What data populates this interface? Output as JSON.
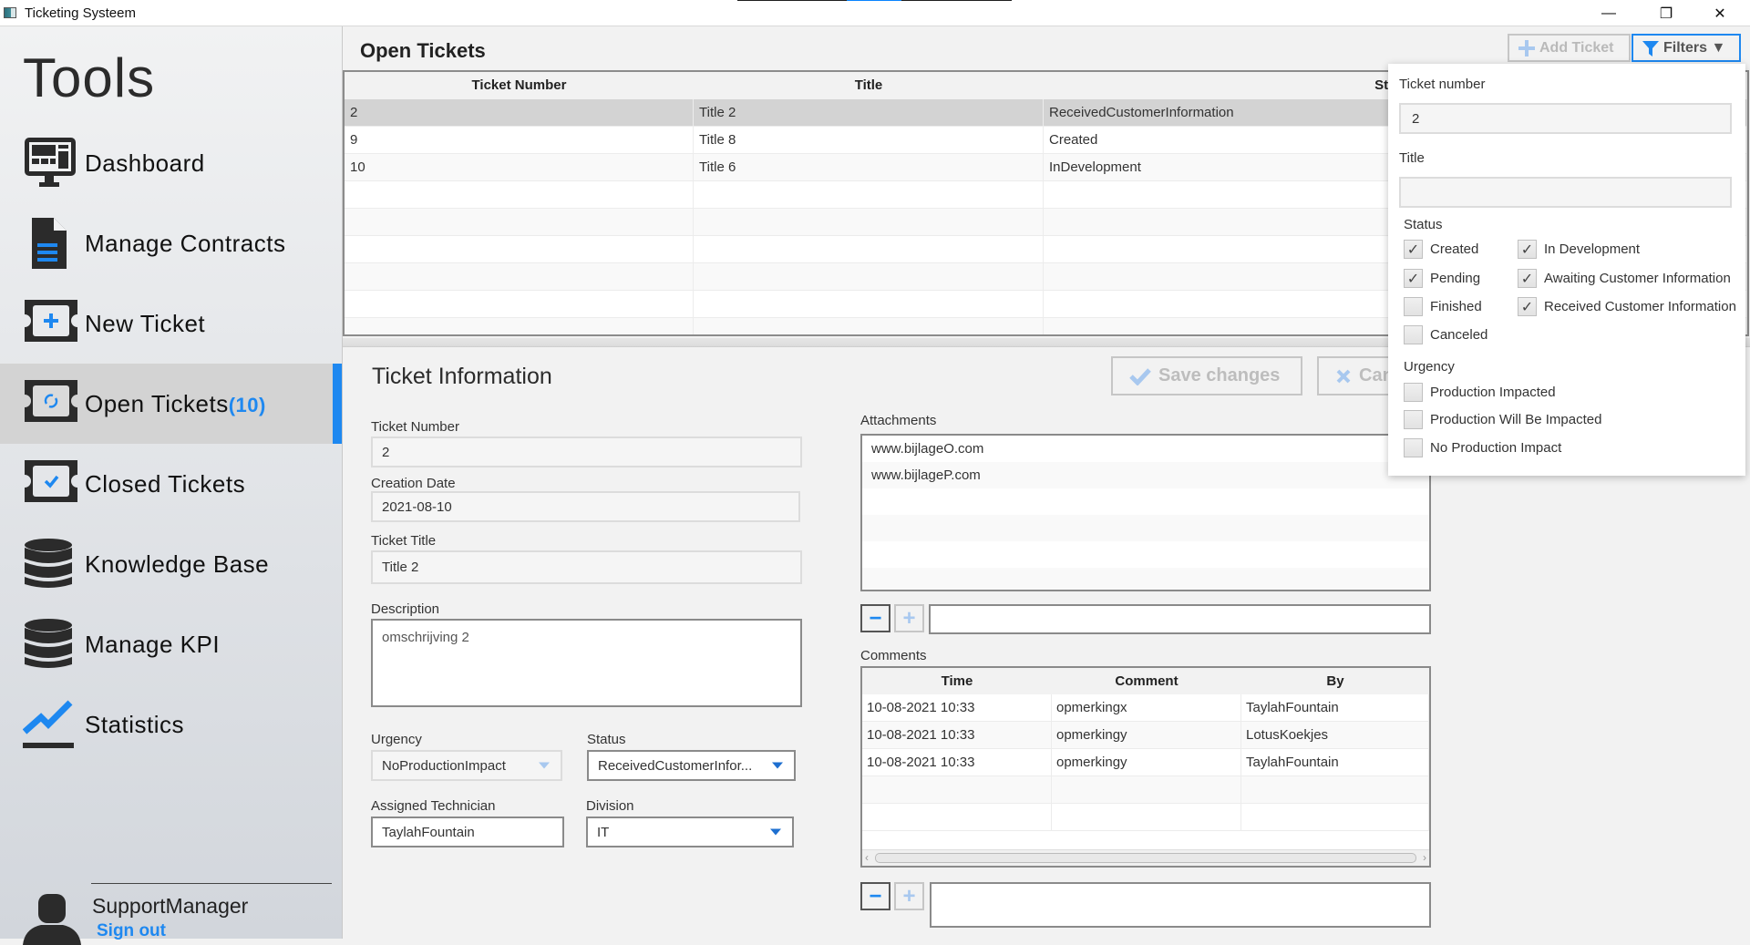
{
  "window": {
    "title": "Ticketing Systeem",
    "controls": {
      "minimize": "—",
      "maximize": "❐",
      "close": "✕"
    }
  },
  "sidebar": {
    "heading": "Tools",
    "items": [
      {
        "label": "Dashboard",
        "icon": "monitor-icon",
        "active": false
      },
      {
        "label": "Manage Contracts",
        "icon": "document-icon",
        "active": false
      },
      {
        "label": "New Ticket",
        "icon": "ticket-plus-icon",
        "active": false
      },
      {
        "label": "Open Tickets",
        "count": "(10)",
        "icon": "ticket-refresh-icon",
        "active": true
      },
      {
        "label": "Closed Tickets",
        "icon": "ticket-check-icon",
        "active": false
      },
      {
        "label": "Knowledge Base",
        "icon": "database-icon",
        "active": false
      },
      {
        "label": "Manage KPI",
        "icon": "database-icon",
        "active": false
      },
      {
        "label": "Statistics",
        "icon": "chart-line-icon",
        "active": false
      }
    ],
    "user": {
      "name": "SupportManager",
      "signout": "Sign out"
    }
  },
  "main": {
    "title": "Open Tickets",
    "add_ticket": "Add Ticket",
    "filters": "Filters ▼",
    "tickets_table": {
      "columns": [
        "Ticket Number",
        "Title",
        "Status"
      ],
      "rows": [
        [
          "2",
          "Title 2",
          "ReceivedCustomerInformation"
        ],
        [
          "9",
          "Title 8",
          "Created"
        ],
        [
          "10",
          "Title 6",
          "InDevelopment"
        ]
      ],
      "selected_index": 0
    },
    "ticket_info": {
      "heading": "Ticket Information",
      "save_label": "Save changes",
      "cancel_label": "Cancel",
      "ticket_number_label": "Ticket Number",
      "ticket_number": "2",
      "creation_date_label": "Creation Date",
      "creation_date": "2021-08-10",
      "ticket_title_label": "Ticket Title",
      "ticket_title": "Title 2",
      "description_label": "Description",
      "description": "omschrijving 2",
      "urgency_label": "Urgency",
      "urgency": "NoProductionImpact",
      "status_label": "Status",
      "status": "ReceivedCustomerInfor...",
      "technician_label": "Assigned Technician",
      "technician": "TaylahFountain",
      "division_label": "Division",
      "division": "IT",
      "attachments_label": "Attachments",
      "attachments": [
        "www.bijlageO.com",
        "www.bijlageP.com"
      ],
      "comments_label": "Comments",
      "comments_columns": [
        "Time",
        "Comment",
        "By"
      ],
      "comments": [
        [
          "10-08-2021 10:33",
          "opmerkingx",
          "TaylahFountain"
        ],
        [
          "10-08-2021 10:33",
          "opmerkingy",
          "LotusKoekjes"
        ],
        [
          "10-08-2021 10:33",
          "opmerkingy",
          "TaylahFountain"
        ]
      ]
    }
  },
  "filter_popup": {
    "ticket_number_label": "Ticket number",
    "ticket_number": "2",
    "title_label": "Title",
    "title": "",
    "status_label": "Status",
    "status_options": [
      {
        "label": "Created",
        "checked": true
      },
      {
        "label": "In Development",
        "checked": true
      },
      {
        "label": "Pending",
        "checked": true
      },
      {
        "label": "Awaiting Customer Information",
        "checked": true
      },
      {
        "label": "Finished",
        "checked": false
      },
      {
        "label": "Received Customer Information",
        "checked": true
      },
      {
        "label": "Canceled",
        "checked": false
      }
    ],
    "urgency_label": "Urgency",
    "urgency_options": [
      {
        "label": "Production Impacted",
        "checked": false
      },
      {
        "label": "Production Will Be Impacted",
        "checked": false
      },
      {
        "label": "No Production Impact",
        "checked": false
      }
    ]
  },
  "colors": {
    "accent": "#1e88f0",
    "sidebar_active": "#d3d3d3",
    "panel": "#f2f2f2"
  }
}
